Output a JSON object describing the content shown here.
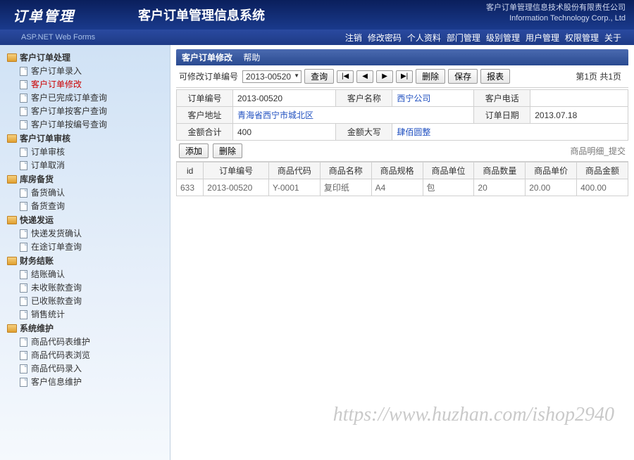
{
  "header": {
    "logo": "订单管理",
    "sublogo": "ASP.NET Web Forms",
    "systemTitle": "客户订单管理信息系统",
    "companyCn": "客户订单管理信息技术股份有限责任公司",
    "companyEn": "Information Technology Corp., Ltd"
  },
  "topnav": {
    "items": [
      "注销",
      "修改密码",
      "个人资料",
      "部门管理",
      "级别管理",
      "用户管理",
      "权限管理",
      "关于"
    ]
  },
  "sidebar": {
    "groups": [
      {
        "label": "客户订单处理",
        "items": [
          "客户订单录入",
          "客户订单修改",
          "客户已完成订单查询",
          "客户订单按客户查询",
          "客户订单按编号查询"
        ],
        "activeIndex": 1
      },
      {
        "label": "客户订单审核",
        "items": [
          "订单审核",
          "订单取消"
        ]
      },
      {
        "label": "库房备货",
        "items": [
          "备货确认",
          "备货查询"
        ]
      },
      {
        "label": "快递发运",
        "items": [
          "快递发货确认",
          "在途订单查询"
        ]
      },
      {
        "label": "财务结账",
        "items": [
          "结账确认",
          "未收账款查询",
          "已收账款查询",
          "销售统计"
        ]
      },
      {
        "label": "系统维护",
        "items": [
          "商品代码表维护",
          "商品代码表浏览",
          "商品代码录入",
          "客户信息维护"
        ]
      }
    ]
  },
  "tabs": {
    "main": "客户订单修改",
    "help": "帮助"
  },
  "toolbar": {
    "editableLabel": "可修改订单编号",
    "selectedOrder": "2013-00520",
    "query": "查询",
    "first": "|◀",
    "prev": "◀",
    "next": "▶",
    "last": "▶|",
    "delete": "删除",
    "save": "保存",
    "report": "报表",
    "pageInfo": "第1页 共1页"
  },
  "form": {
    "labels": {
      "orderNo": "订单编号",
      "custName": "客户名称",
      "custPhone": "客户电话",
      "custAddr": "客户地址",
      "orderDate": "订单日期",
      "total": "金额合计",
      "totalCn": "金额大写"
    },
    "values": {
      "orderNo": "2013-00520",
      "custName": "西宁公司",
      "custPhone": "",
      "custAddr": "青海省西宁市城北区",
      "orderDate": "2013.07.18",
      "total": "400",
      "totalCn": "肆佰圆整"
    }
  },
  "detailBar": {
    "add": "添加",
    "delete": "删除",
    "submitLabel": "商品明细_提交"
  },
  "grid": {
    "headers": [
      "id",
      "订单编号",
      "商品代码",
      "商品名称",
      "商品规格",
      "商品单位",
      "商品数量",
      "商品单价",
      "商品金额"
    ],
    "rows": [
      [
        "633",
        "2013-00520",
        "Y-0001",
        "复印纸",
        "A4",
        "包",
        "20",
        "20.00",
        "400.00"
      ]
    ]
  },
  "watermark": "https://www.huzhan.com/ishop2940"
}
